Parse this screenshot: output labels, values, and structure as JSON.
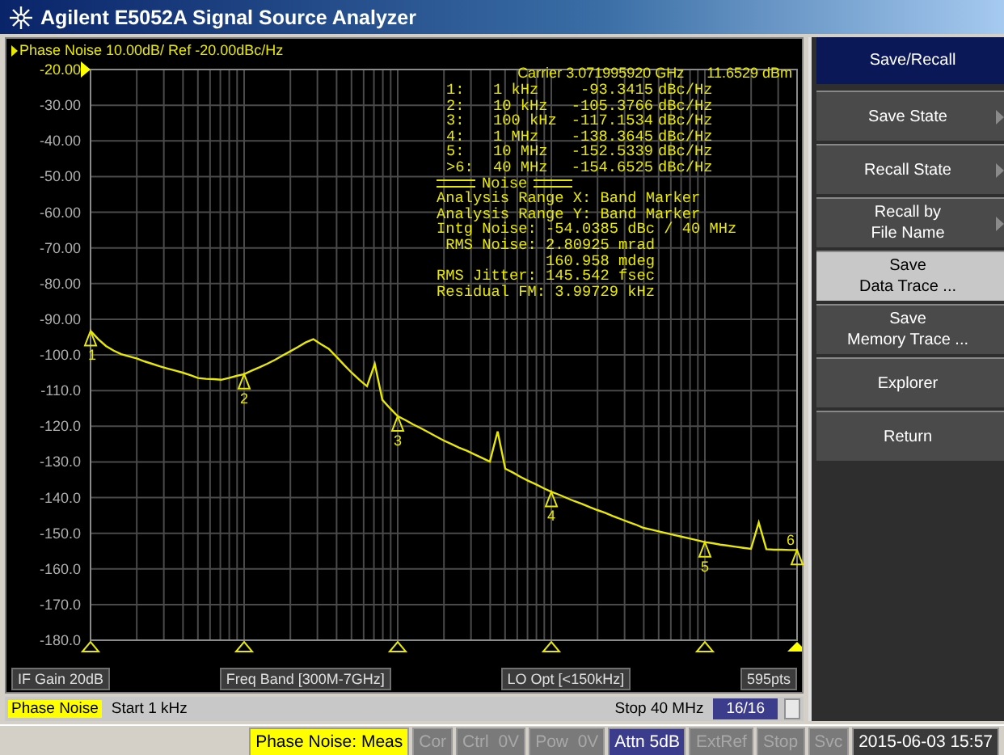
{
  "window": {
    "title": "Agilent E5052A Signal Source Analyzer"
  },
  "trace_header": "Phase Noise 10.00dB/ Ref -20.00dBc/Hz",
  "chart": {
    "markers": [
      "1",
      "2",
      "3",
      "4",
      "5",
      "6"
    ],
    "chart_data": {
      "type": "line",
      "grid": true,
      "ylim": [
        -180,
        -20
      ],
      "yticks": [
        {
          "value": -20,
          "label": "-20.00"
        },
        {
          "value": -30,
          "label": "-30.00"
        },
        {
          "value": -40,
          "label": "-40.00"
        },
        {
          "value": -50,
          "label": "-50.00"
        },
        {
          "value": -60,
          "label": "-60.00"
        },
        {
          "value": -70,
          "label": "-70.00"
        },
        {
          "value": -80,
          "label": "-80.00"
        },
        {
          "value": -90,
          "label": "-90.00"
        },
        {
          "value": -100,
          "label": "-100.0"
        },
        {
          "value": -110,
          "label": "-110.0"
        },
        {
          "value": -120,
          "label": "-120.0"
        },
        {
          "value": -130,
          "label": "-130.0"
        },
        {
          "value": -140,
          "label": "-140.0"
        },
        {
          "value": -150,
          "label": "-150.0"
        },
        {
          "value": -160,
          "label": "-160.0"
        },
        {
          "value": -170,
          "label": "-170.0"
        },
        {
          "value": -180,
          "label": "-180.0"
        }
      ],
      "categories": [
        null,
        null,
        null,
        null,
        null,
        null,
        null,
        null,
        null,
        null,
        null,
        null,
        null,
        null,
        null,
        null,
        null,
        null,
        null,
        null,
        null,
        null,
        null,
        null,
        null,
        null,
        null,
        null,
        null,
        null,
        null,
        null,
        null,
        null,
        null,
        null,
        null,
        null,
        null,
        null,
        null,
        null,
        null,
        null,
        null,
        null,
        null,
        null,
        null,
        null,
        null,
        null,
        null,
        null,
        null,
        null,
        null,
        null,
        null,
        null,
        null,
        null,
        null,
        null,
        null,
        null,
        null,
        null,
        null,
        null,
        null,
        null,
        null,
        null,
        null,
        null,
        null,
        null,
        null,
        null,
        null,
        null,
        null,
        null,
        null,
        null,
        null,
        null,
        null,
        null,
        null,
        null,
        null
      ],
      "series": [
        {
          "color": "#e8e800",
          "values": [
            -93.3,
            -95.6,
            -97.5,
            -98.8,
            -99.8,
            -100.4,
            -101.0,
            -101.8,
            -102.5,
            -103.2,
            -103.8,
            -104.4,
            -105.0,
            -105.7,
            -106.5,
            -106.7,
            -106.8,
            -107.0,
            -106.5,
            -105.9,
            -105.4,
            -104.4,
            -103.5,
            -102.5,
            -101.4,
            -100.2,
            -99.0,
            -97.8,
            -96.5,
            -95.6,
            -97.0,
            -98.3,
            -100.5,
            -102.8,
            -105.0,
            -107.0,
            -108.8,
            -102.5,
            -112.6,
            -115.0,
            -117.2,
            -118.3,
            -119.5,
            -120.6,
            -121.7,
            -122.9,
            -124.0,
            -125.0,
            -126.0,
            -126.9,
            -127.9,
            -128.9,
            -129.9,
            -121.5,
            -131.9,
            -133.0,
            -134.2,
            -135.3,
            -136.3,
            -137.4,
            -138.4,
            -139.2,
            -140.1,
            -141.0,
            -141.8,
            -142.7,
            -143.5,
            -144.3,
            -145.2,
            -146.0,
            -146.8,
            -147.6,
            -148.5,
            -149.0,
            -149.5,
            -150.0,
            -150.5,
            -151.0,
            -151.5,
            -152.0,
            -152.5,
            -152.8,
            -153.2,
            -153.5,
            -153.8,
            -154.1,
            -154.4,
            -147.0,
            -154.5,
            -154.6,
            -154.6,
            -154.7,
            -154.7
          ]
        }
      ]
    }
  },
  "readout": {
    "carrier": "Carrier 3.071995920 GHz",
    "power": "11.6529 dBm",
    "markers": [
      {
        "index": "1:",
        "freq": "1 kHz",
        "value": "-93.3415",
        "unit": "dBc/Hz"
      },
      {
        "index": "2:",
        "freq": "10 kHz",
        "value": "-105.3766",
        "unit": "dBc/Hz"
      },
      {
        "index": "3:",
        "freq": "100 kHz",
        "value": "-117.1534",
        "unit": "dBc/Hz"
      },
      {
        "index": "4:",
        "freq": "1 MHz",
        "value": "-138.3645",
        "unit": "dBc/Hz"
      },
      {
        "index": "5:",
        "freq": "10 MHz",
        "value": "-152.5339",
        "unit": "dBc/Hz"
      },
      {
        "index": ">6:",
        "freq": "40 MHz",
        "value": "-154.6525",
        "unit": "dBc/Hz"
      }
    ],
    "section": "Noise",
    "lines": [
      "Analysis Range X: Band Marker",
      "Analysis Range Y: Band Marker",
      "Intg Noise: -54.0385 dBc / 40 MHz",
      " RMS Noise: 2.80925 mrad",
      "            160.958 mdeg",
      "RMS Jitter: 145.542 fsec",
      "Residual FM: 3.99729 kHz"
    ]
  },
  "info_bar": [
    "IF Gain 20dB",
    "Freq Band [300M-7GHz]",
    "LO Opt [<150kHz]",
    "595pts"
  ],
  "channel_bar": {
    "measurement": "Phase Noise",
    "start": "Start 1 kHz",
    "stop": "Stop 40 MHz",
    "traces": "16/16"
  },
  "softkeys": {
    "title": "Save/Recall",
    "items": [
      {
        "label": "Save State",
        "submenu": true,
        "selected": false
      },
      {
        "label": "Recall State",
        "submenu": true,
        "selected": false
      },
      {
        "label": "Recall by\nFile Name",
        "submenu": true,
        "selected": false
      },
      {
        "label": "Save\nData Trace ...",
        "submenu": false,
        "selected": true
      },
      {
        "label": "Save\nMemory Trace ...",
        "submenu": false,
        "selected": false
      },
      {
        "label": "Explorer",
        "submenu": false,
        "selected": false
      },
      {
        "label": "Return",
        "submenu": false,
        "selected": false
      }
    ]
  },
  "status_bar": [
    {
      "text": "Phase Noise: Meas",
      "kind": "highlight"
    },
    {
      "text": "Cor",
      "kind": "inactive"
    },
    {
      "text": "Ctrl  0V",
      "kind": "inactive"
    },
    {
      "text": "Pow  0V",
      "kind": "inactive"
    },
    {
      "text": "Attn 5dB",
      "kind": "active"
    },
    {
      "text": "ExtRef",
      "kind": "inactive"
    },
    {
      "text": "Stop",
      "kind": "inactive"
    },
    {
      "text": "Svc",
      "kind": "inactive"
    },
    {
      "text": "2015-06-03 15:57",
      "kind": "clock"
    }
  ]
}
